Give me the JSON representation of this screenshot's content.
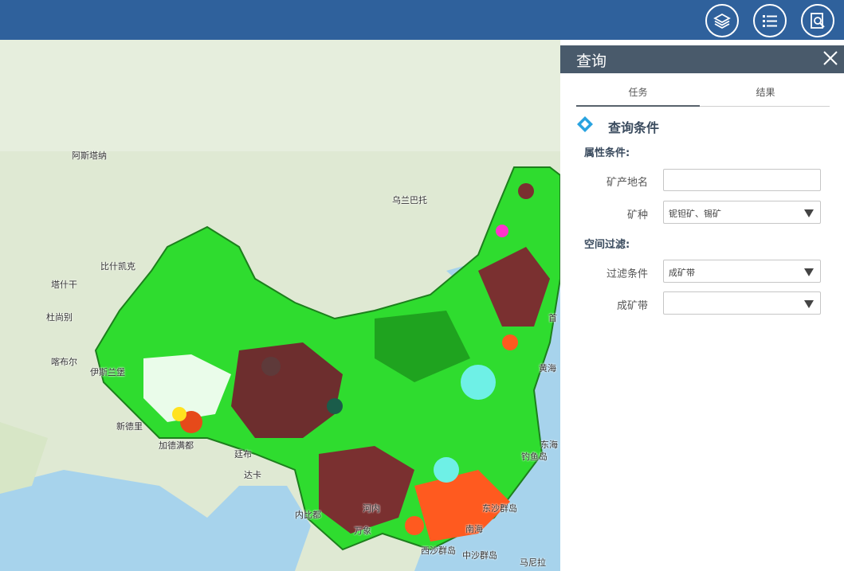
{
  "header": {
    "buttons": [
      {
        "name": "layers-button",
        "icon": "layers-icon"
      },
      {
        "name": "list-button",
        "icon": "list-icon"
      },
      {
        "name": "query-button",
        "icon": "search-document-icon"
      }
    ],
    "bg_color": "#2f619c"
  },
  "map": {
    "labels": [
      {
        "id": "kazakhstan",
        "text": "阿斯塔纳"
      },
      {
        "id": "ulanbator",
        "text": "乌兰巴托"
      },
      {
        "id": "bishkek",
        "text": "比什凯克"
      },
      {
        "id": "tashkent",
        "text": "塔什干"
      },
      {
        "id": "dushanbe",
        "text": "杜尚别"
      },
      {
        "id": "kabul",
        "text": "喀布尔"
      },
      {
        "id": "islamabad",
        "text": "伊斯兰堡"
      },
      {
        "id": "delhi",
        "text": "新德里"
      },
      {
        "id": "kathmandu",
        "text": "加德满都"
      },
      {
        "id": "thimphu",
        "text": "廷布"
      },
      {
        "id": "dhaka",
        "text": "达卡"
      },
      {
        "id": "naypyidaw",
        "text": "内比都"
      },
      {
        "id": "hanoi",
        "text": "河内"
      },
      {
        "id": "vientiane",
        "text": "万象"
      },
      {
        "id": "yellow-sea",
        "text": "黄海"
      },
      {
        "id": "east-sea",
        "text": "东海"
      },
      {
        "id": "diaoyu",
        "text": "钓鱼岛"
      },
      {
        "id": "dongsha",
        "text": "东沙群岛"
      },
      {
        "id": "south-sea",
        "text": "南海"
      },
      {
        "id": "xisha",
        "text": "西沙群岛"
      },
      {
        "id": "zhongsha",
        "text": "中沙群岛"
      },
      {
        "id": "manila",
        "text": "马尼拉"
      },
      {
        "id": "seoul-partial",
        "text": "首"
      }
    ]
  },
  "panel": {
    "title": "查询",
    "tabs": [
      {
        "label": "任务",
        "active": true
      },
      {
        "label": "结果",
        "active": false
      }
    ],
    "section_title": "查询条件",
    "attr_title": "属性条件:",
    "spatial_title": "空间过滤:",
    "fields": {
      "mine_name": {
        "label": "矿产地名",
        "value": ""
      },
      "mineral": {
        "label": "矿种",
        "value": "铌钽矿、锡矿"
      },
      "filter": {
        "label": "过滤条件",
        "value": "成矿带"
      },
      "belt": {
        "label": "成矿带",
        "value": ""
      }
    },
    "accent_color": "#29a3e0"
  }
}
